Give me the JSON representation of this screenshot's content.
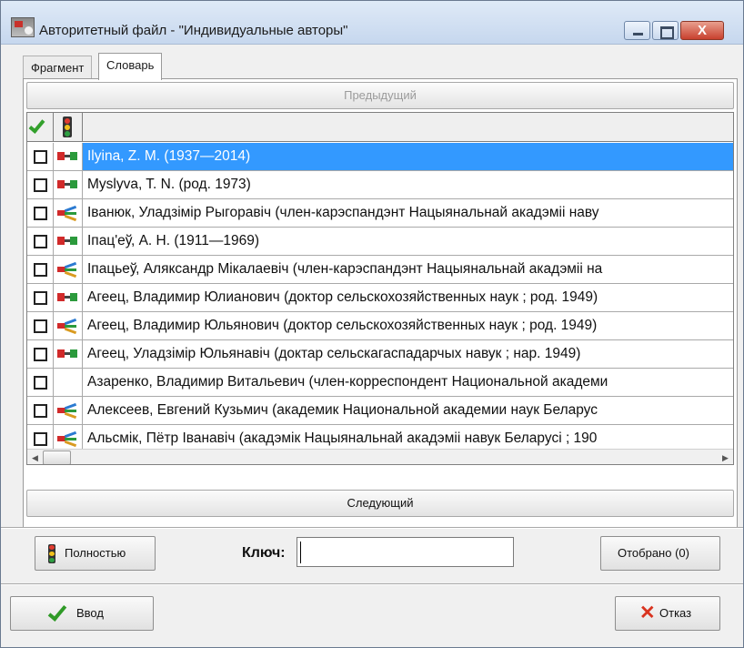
{
  "window": {
    "title": "Авторитетный файл - \"Индивидуальные авторы\"",
    "close_glyph": "X"
  },
  "tabs": [
    {
      "label": "Фрагмент"
    },
    {
      "label": "Словарь"
    }
  ],
  "nav": {
    "prev_label": "Предыдущий",
    "next_label": "Следующий"
  },
  "table": {
    "rows": [
      {
        "text": "Ilyina, Z. M. (1937—2014)",
        "icon": "linked-pair-icon",
        "selected": true
      },
      {
        "text": "Myslyva, T. N. (род. 1973)",
        "icon": "linked-pair-icon",
        "selected": false
      },
      {
        "text": "Іванюк, Уладзімір Рыгоравіч (член-карэспандэнт Нацыянальнай акадэміі наву",
        "icon": "multi-link-icon",
        "selected": false
      },
      {
        "text": "Іпац'еў, А. Н. (1911—1969)",
        "icon": "linked-pair-icon",
        "selected": false
      },
      {
        "text": "Іпацьеў, Аляксандр Мікалаевіч (член-карэспандэнт Нацыянальнай акадэміі на",
        "icon": "multi-link-icon",
        "selected": false
      },
      {
        "text": "Агеец, Владимир Юлианович (доктор сельскохозяйственных наук ; род. 1949)",
        "icon": "linked-pair-icon",
        "selected": false
      },
      {
        "text": "Агеец, Владимир Юльянович (доктор сельскохозяйственных наук ; род. 1949)",
        "icon": "multi-link-icon",
        "selected": false
      },
      {
        "text": "Агеец, Уладзімір Юльянавіч (доктар сельскагаспадарчых навук ; нар. 1949)",
        "icon": "linked-pair-icon",
        "selected": false
      },
      {
        "text": "Азаренко, Владимир Витальевич (член-корреспондент Национальной академи",
        "icon": "",
        "selected": false
      },
      {
        "text": "Алексеев, Евгений Кузьмич (академик Национальной академии наук Беларус",
        "icon": "multi-link-icon",
        "selected": false
      },
      {
        "text": "Альсмік, Пётр Іванавіч (акадэмік Нацыянальнай акадэміі навук Беларусі ; 190",
        "icon": "multi-link-icon",
        "selected": false
      }
    ]
  },
  "buttons": {
    "full": "Полностью",
    "selected": "Отобрано (0)",
    "enter": "Ввод",
    "cancel": "Отказ"
  },
  "key": {
    "label": "Ключ:",
    "value": ""
  },
  "colors": {
    "selection": "#3399ff",
    "check_green": "#33a02c",
    "cancel_red": "#d9331f"
  }
}
